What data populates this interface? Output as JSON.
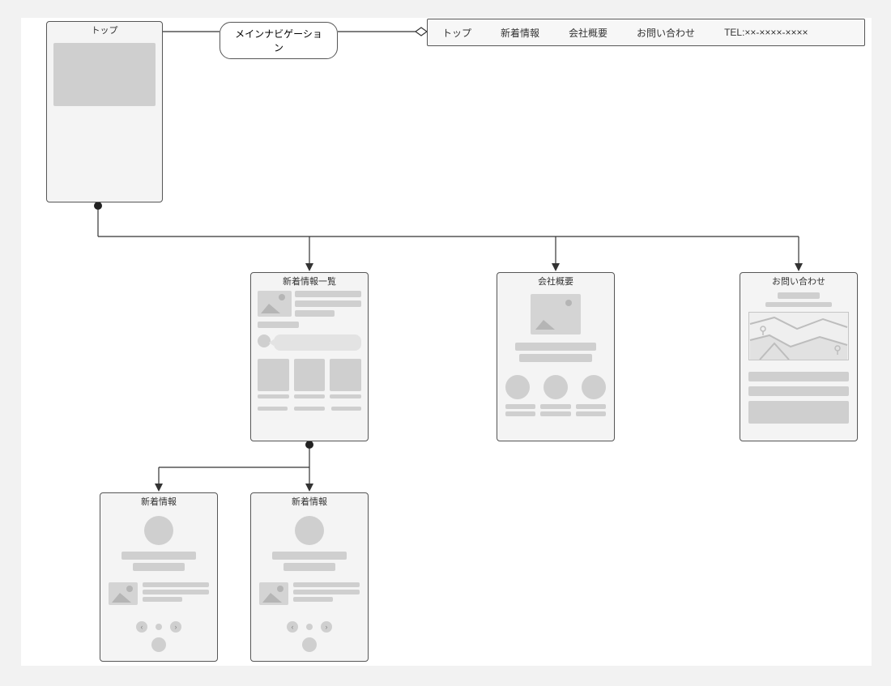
{
  "nodes": {
    "top": {
      "title": "トップ"
    },
    "main_nav_label": "メインナビゲーション",
    "nav_items": [
      "トップ",
      "新着情報",
      "会社概要",
      "お問い合わせ",
      "TEL:××-××××-××××"
    ],
    "news_list": {
      "title": "新着情報一覧"
    },
    "company": {
      "title": "会社概要"
    },
    "contact": {
      "title": "お問い合わせ"
    },
    "news_detail_a": {
      "title": "新着情報"
    },
    "news_detail_b": {
      "title": "新着情報"
    }
  }
}
